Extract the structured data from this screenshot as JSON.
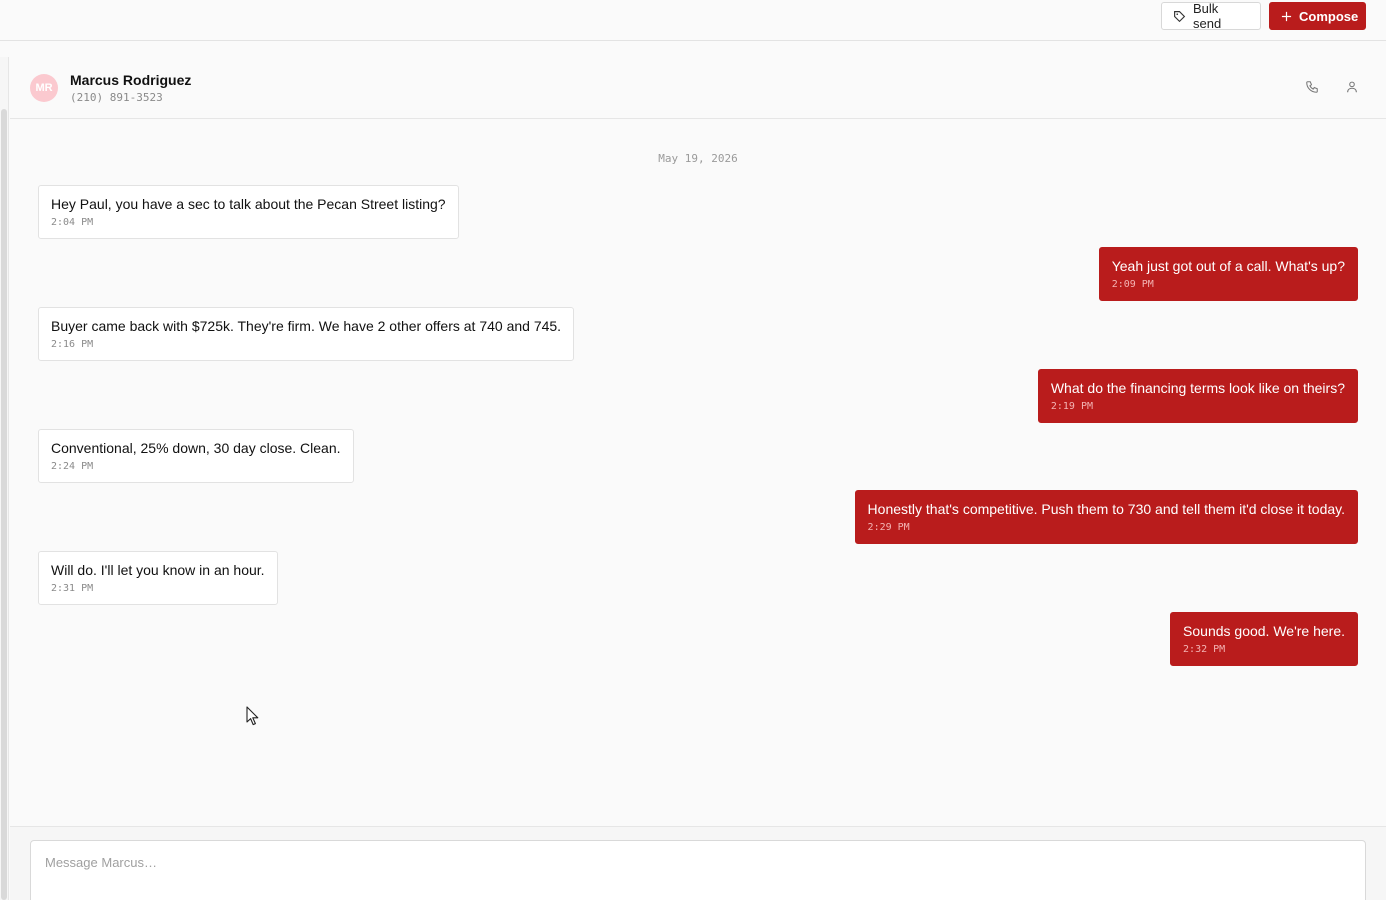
{
  "toolbar": {
    "bulk_send_label": "Bulk send",
    "compose_label": "Compose"
  },
  "contact": {
    "initials": "MR",
    "name": "Marcus Rodriguez",
    "phone": "(210) 891-3523"
  },
  "conversation": {
    "date": "May 19, 2026",
    "messages": [
      {
        "direction": "in",
        "text": "Hey Paul, you have a sec to talk about the Pecan Street listing?",
        "time": "2:04 PM"
      },
      {
        "direction": "out",
        "text": "Yeah just got out of a call. What's up?",
        "time": "2:09 PM"
      },
      {
        "direction": "in",
        "text": "Buyer came back with $725k. They're firm. We have 2 other offers at 740 and 745.",
        "time": "2:16 PM"
      },
      {
        "direction": "out",
        "text": "What do the financing terms look like on theirs?",
        "time": "2:19 PM"
      },
      {
        "direction": "in",
        "text": "Conventional, 25% down, 30 day close. Clean.",
        "time": "2:24 PM"
      },
      {
        "direction": "out",
        "text": "Honestly that's competitive. Push them to 730 and tell them it'd close it today.",
        "time": "2:29 PM"
      },
      {
        "direction": "in",
        "text": "Will do. I'll let you know in an hour.",
        "time": "2:31 PM"
      },
      {
        "direction": "out",
        "text": "Sounds good. We're here.",
        "time": "2:32 PM"
      }
    ]
  },
  "composer": {
    "placeholder": "Message Marcus…",
    "value": ""
  },
  "colors": {
    "accent": "#b91c1c",
    "avatar_bg": "#fbc9cf"
  },
  "icons": [
    "tag-icon",
    "plus-icon",
    "phone-icon",
    "person-icon",
    "mouse-cursor-icon"
  ]
}
